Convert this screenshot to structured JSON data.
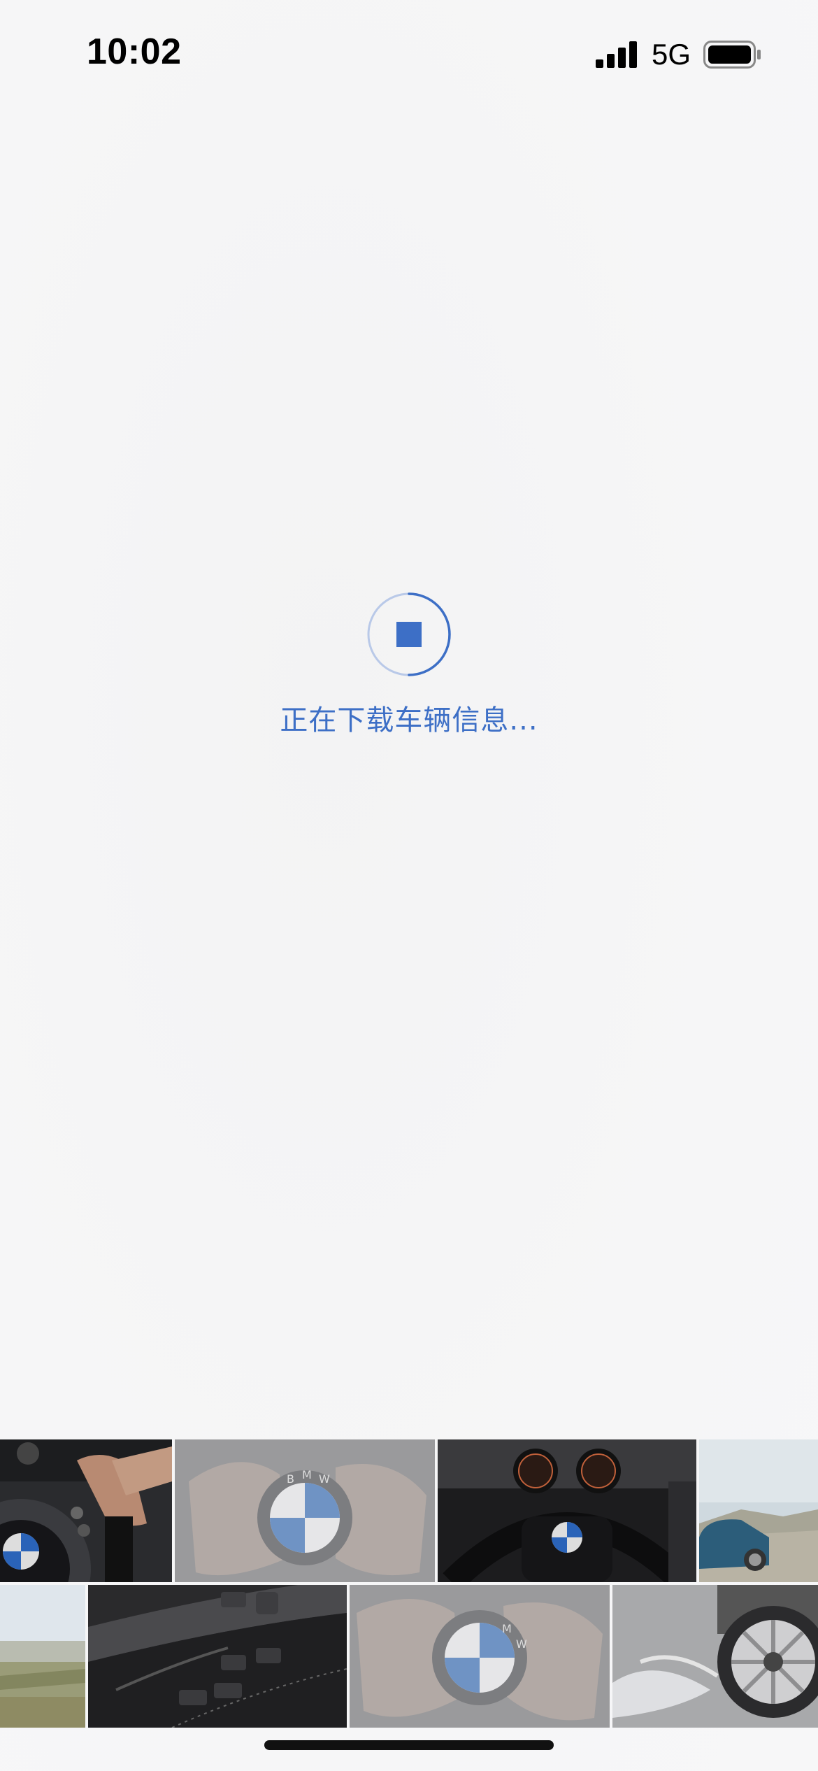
{
  "status_bar": {
    "time": "10:02",
    "network": "5G",
    "signal_icon": "cellular-signal-icon",
    "battery_icon": "battery-icon"
  },
  "loader": {
    "icon": "stop-loading-icon",
    "message": "正在下载车辆信息...",
    "accent_color": "#3d6fc6"
  },
  "photo_strip": {
    "row_1": [
      {
        "name": "steering-wheel-hand-photo"
      },
      {
        "name": "bmw-emblem-hands-photo"
      },
      {
        "name": "dashboard-steering-wheel-photo"
      },
      {
        "name": "blue-car-landscape-photo"
      }
    ],
    "row_2": [
      {
        "name": "grassland-landscape-photo"
      },
      {
        "name": "door-panel-controls-photo"
      },
      {
        "name": "bmw-emblem-hands-photo-2"
      },
      {
        "name": "wheel-splash-photo"
      }
    ]
  }
}
